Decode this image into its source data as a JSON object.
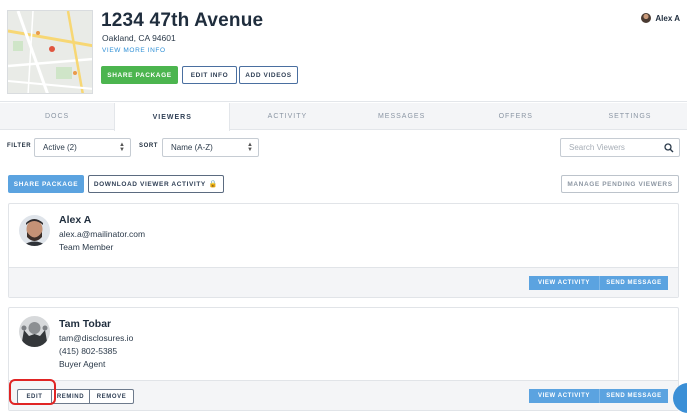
{
  "property": {
    "address": "1234 47th Avenue",
    "city_line": "Oakland, CA 94601",
    "view_more": "VIEW MORE INFO"
  },
  "header_actions": {
    "share": "SHARE PACKAGE",
    "edit_info": "EDIT INFO",
    "add_videos": "ADD VIDEOS"
  },
  "user": {
    "name": "Alex A"
  },
  "tabs": [
    {
      "label": "DOCS",
      "active": false
    },
    {
      "label": "VIEWERS",
      "active": true
    },
    {
      "label": "ACTIVITY",
      "active": false
    },
    {
      "label": "MESSAGES",
      "active": false
    },
    {
      "label": "OFFERS",
      "active": false
    },
    {
      "label": "SETTINGS",
      "active": false
    }
  ],
  "filters": {
    "filter_label": "FILTER",
    "filter_value": "Active (2)",
    "sort_label": "SORT",
    "sort_value": "Name (A-Z)",
    "search_placeholder": "Search Viewers"
  },
  "toolbar": {
    "share": "SHARE PACKAGE",
    "download": "DOWNLOAD VIEWER ACTIVITY",
    "manage_pending": "MANAGE PENDING VIEWERS"
  },
  "viewers": [
    {
      "name": "Alex A",
      "email": "alex.a@mailinator.com",
      "role": "Team Member",
      "view_activity": "VIEW ACTIVITY",
      "send_message": "SEND MESSAGE"
    },
    {
      "name": "Tam Tobar",
      "email": "tam@disclosures.io",
      "phone": "(415) 802-5385",
      "role": "Buyer Agent",
      "edit": "EDIT",
      "remind": "REMIND",
      "remove": "REMOVE",
      "view_activity": "VIEW ACTIVITY",
      "send_message": "SEND MESSAGE"
    }
  ],
  "colors": {
    "accent_blue": "#5ba3e0",
    "share_green": "#4cb54f",
    "highlight_red": "#e02424"
  },
  "icons": [
    "user-avatar-icon",
    "chevron-updown-icon",
    "search-icon",
    "lock-icon",
    "chat-icon"
  ]
}
